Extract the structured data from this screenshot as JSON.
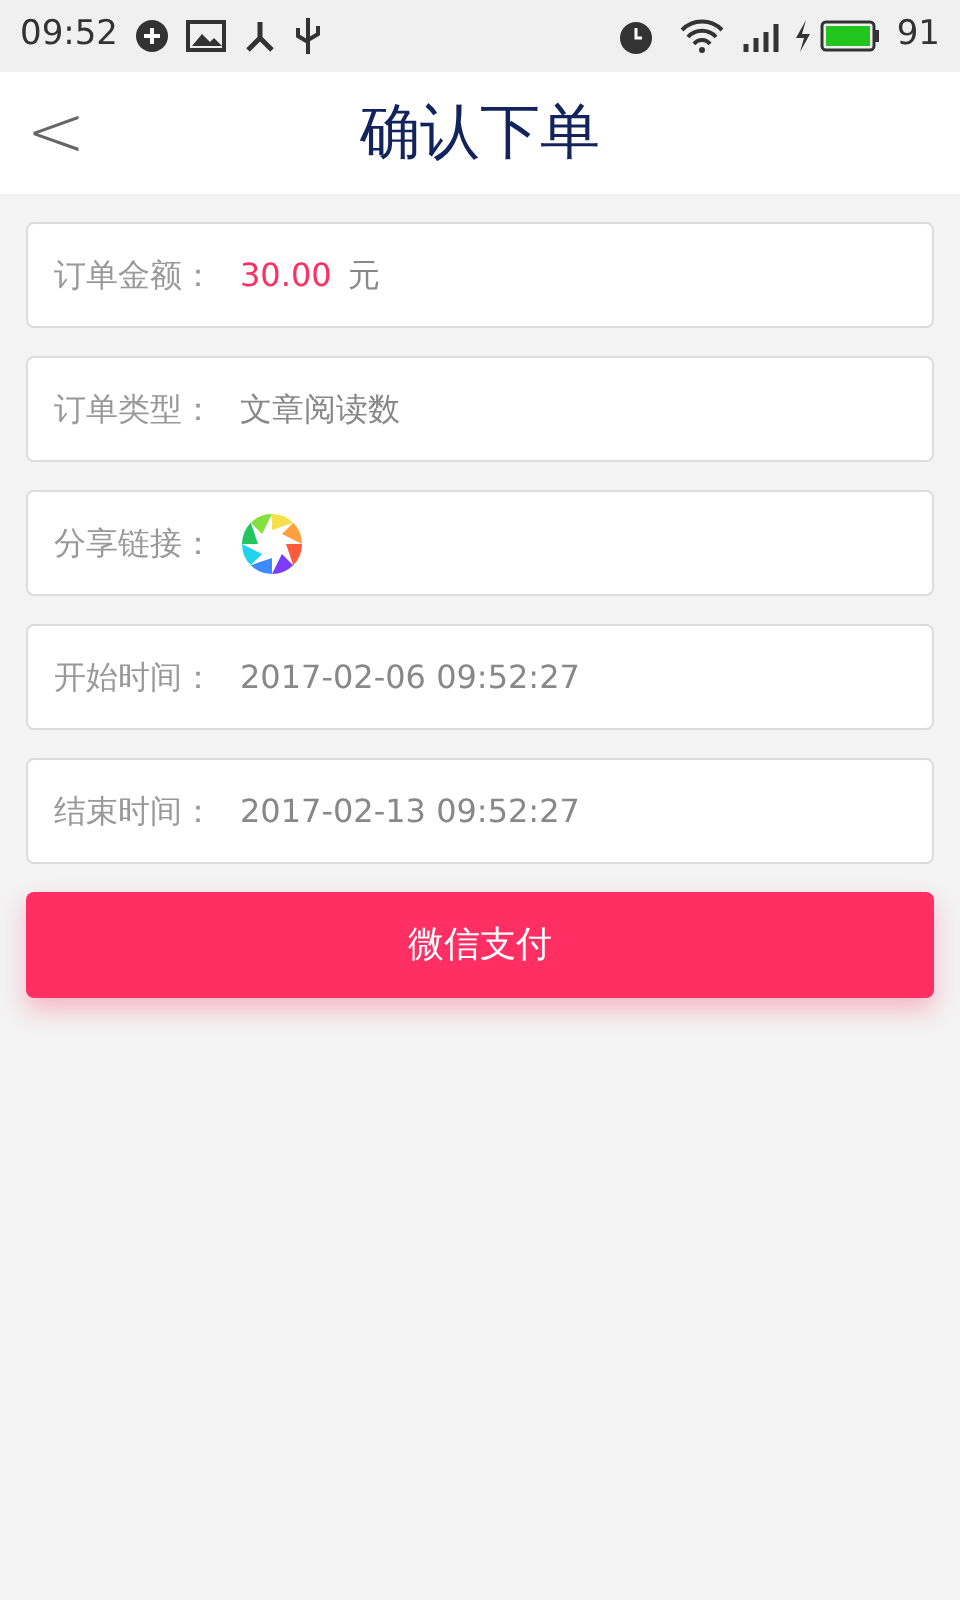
{
  "status_bar": {
    "time": "09:52",
    "battery": "91"
  },
  "header": {
    "back": "<",
    "title": "确认下单"
  },
  "rows": [
    {
      "kind": "amount",
      "label": "订单金额：",
      "value": "30.00",
      "unit": "元"
    },
    {
      "kind": "text",
      "label": "订单类型：",
      "value": "文章阅读数"
    },
    {
      "kind": "image",
      "label": "分享链接："
    },
    {
      "kind": "text",
      "label": "开始时间：",
      "value": "2017-02-06 09:52:27"
    },
    {
      "kind": "text",
      "label": "结束时间：",
      "value": "2017-02-13 09:52:27"
    }
  ],
  "pay_button": "微信支付"
}
